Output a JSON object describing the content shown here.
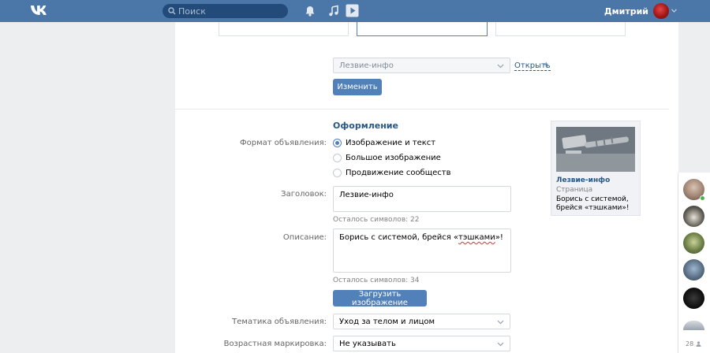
{
  "header": {
    "search_placeholder": "Поиск",
    "user_name": "Дмитрий"
  },
  "page": {
    "page_select_value": "Лезвие-инфо",
    "open_link": "Открыть",
    "open_plus": "+",
    "change_button": "Изменить",
    "section_title": "Оформление",
    "format_label": "Формат объявления:",
    "format_options": [
      "Изображение и текст",
      "Большое изображение",
      "Продвижение сообществ"
    ],
    "selected_format_index": 0,
    "title_label": "Заголовок:",
    "title_value": "Лезвие-инфо",
    "title_hint": "Осталось символов: 22",
    "desc_label": "Описание:",
    "desc_before": "Борись с системой, брейся «",
    "desc_spell": "тэшками",
    "desc_after": "»!",
    "desc_hint": "Осталось символов: 34",
    "upload_button": "Загрузить изображение",
    "topic_label": "Тематика объявления:",
    "topic_value": "Уход за телом и лицом",
    "age_label": "Возрастная маркировка:",
    "age_value": "Не указывать"
  },
  "preview": {
    "title": "Лезвие-инфо",
    "subtitle": "Страница",
    "description": "Борись с системой, брейся «тэшками»!"
  },
  "chat": {
    "count": "28"
  },
  "colors": {
    "header": "#4a76a8",
    "button": "#5181b8",
    "link": "#2a5885",
    "background": "#edeef0"
  },
  "icons": [
    "vk-logo-icon",
    "search-icon",
    "bell-icon",
    "music-icon",
    "video-icon",
    "chevron-down-icon",
    "person-icon"
  ]
}
